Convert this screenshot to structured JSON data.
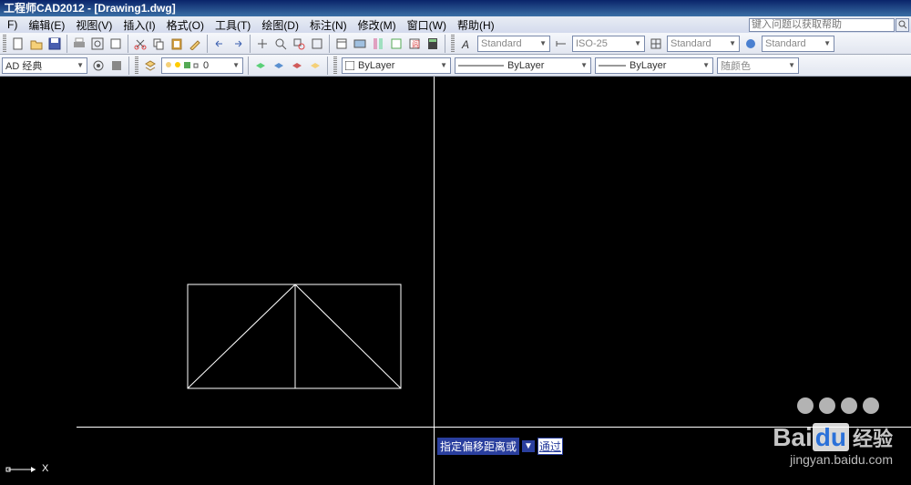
{
  "title": "工程师CAD2012 - [Drawing1.dwg]",
  "menus": [
    "F)",
    "编辑(E)",
    "视图(V)",
    "插入(I)",
    "格式(O)",
    "工具(T)",
    "绘图(D)",
    "标注(N)",
    "修改(M)",
    "窗口(W)",
    "帮助(H)"
  ],
  "search": {
    "placeholder": "键入问题以获取帮助"
  },
  "style_combo1": "Standard",
  "style_combo2": "ISO-25",
  "style_combo3": "Standard",
  "style_combo4": "Standard",
  "workspace": "AD 经典",
  "layer_coord": "0",
  "layer_prop": "ByLayer",
  "linetype": "ByLayer",
  "lineweight": "ByLayer",
  "color_label": "随颜色",
  "prompt_text": "指定偏移距离或",
  "prompt_value": "通过",
  "ucs_label": "X",
  "watermark": {
    "logo_a": "Bai",
    "logo_b": "du",
    "cn": "经验",
    "url": "jingyan.baidu.com"
  }
}
